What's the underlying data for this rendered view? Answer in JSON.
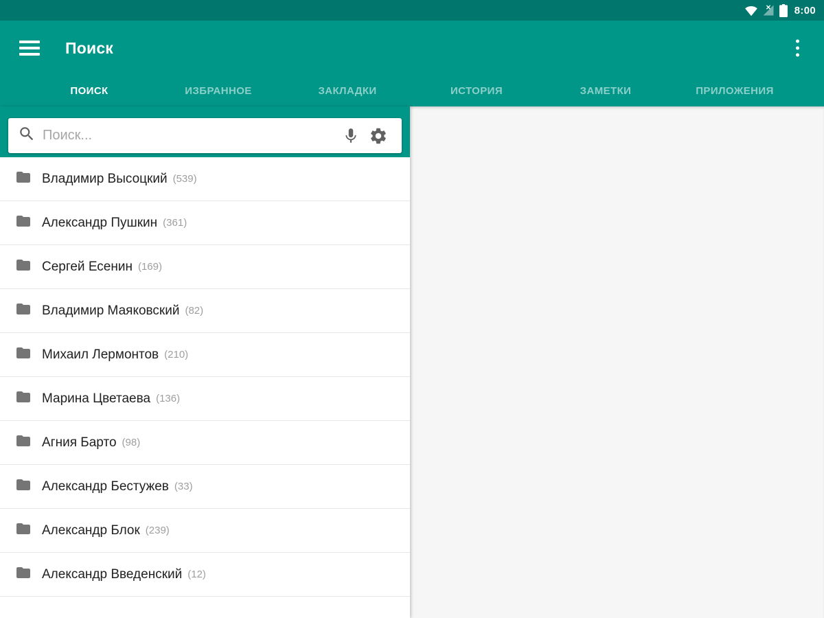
{
  "colors": {
    "primary": "#009688",
    "primary_dark": "#00766C",
    "tab_inactive_text": "rgba(255,255,255,0.55)",
    "icon_gray": "#616161",
    "folder_gray": "#757575",
    "right_panel_bg": "#f6f6f6"
  },
  "status_bar": {
    "time": "8:00",
    "icons": [
      "wifi-icon",
      "cell-signal-no-internet-icon",
      "battery-full-icon"
    ]
  },
  "app_bar": {
    "title": "Поиск"
  },
  "tabs": [
    {
      "label": "ПОИСК",
      "active": true
    },
    {
      "label": "ИЗБРАННОЕ",
      "active": false
    },
    {
      "label": "ЗАКЛАДКИ",
      "active": false
    },
    {
      "label": "ИСТОРИЯ",
      "active": false
    },
    {
      "label": "ЗАМЕТКИ",
      "active": false
    },
    {
      "label": "ПРИЛОЖЕНИЯ",
      "active": false
    }
  ],
  "search": {
    "placeholder": "Поиск...",
    "value": ""
  },
  "folders": [
    {
      "name": "Владимир Высоцкий",
      "count_label": "(539)"
    },
    {
      "name": "Александр Пушкин",
      "count_label": "(361)"
    },
    {
      "name": "Сергей Есенин",
      "count_label": "(169)"
    },
    {
      "name": "Владимир Маяковский",
      "count_label": "(82)"
    },
    {
      "name": "Михаил Лермонтов",
      "count_label": "(210)"
    },
    {
      "name": "Марина Цветаева",
      "count_label": "(136)"
    },
    {
      "name": "Агния Барто",
      "count_label": "(98)"
    },
    {
      "name": "Александр Бестужев",
      "count_label": "(33)"
    },
    {
      "name": "Александр Блок",
      "count_label": "(239)"
    },
    {
      "name": "Александр Введенский",
      "count_label": "(12)"
    }
  ]
}
